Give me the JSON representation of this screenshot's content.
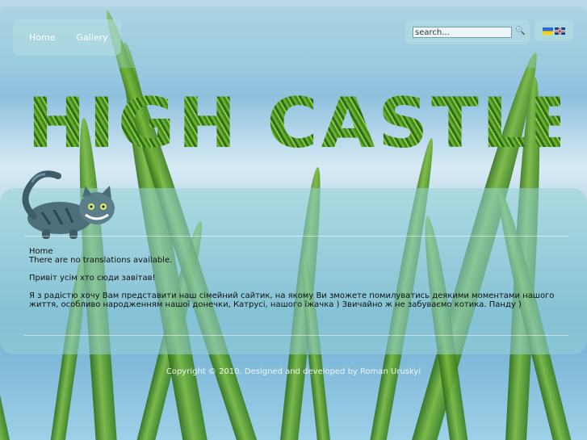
{
  "nav": {
    "items": [
      {
        "label": "Home"
      },
      {
        "label": "Gallery"
      }
    ]
  },
  "search": {
    "value": "search..."
  },
  "languages": [
    {
      "code": "ua",
      "icon": "ukraine-flag-icon"
    },
    {
      "code": "en",
      "icon": "uk-flag-icon"
    }
  ],
  "logo": {
    "text": "HIGH CASTLE"
  },
  "content": {
    "breadcrumb": "Home",
    "notice": "There are no translations available.",
    "greeting": "Привіт усім хто сюди завітав!",
    "body": "Я з радістю хочу Вам представити наш сімейний сайтик, на якому Ви зможете помилуватись деякими моментами нашого життя, особливо народженням нашої донечки, Катрусі, нашого їжачка ) Звичайно ж не забуваємо котика. Панду )"
  },
  "footer": {
    "copyright": "Copyright © 2010. Designed and developed by Roman Uruskyi"
  },
  "colors": {
    "panel": "#96d2d7",
    "grass": "#5fa32c",
    "sky": "#8fc1de"
  }
}
